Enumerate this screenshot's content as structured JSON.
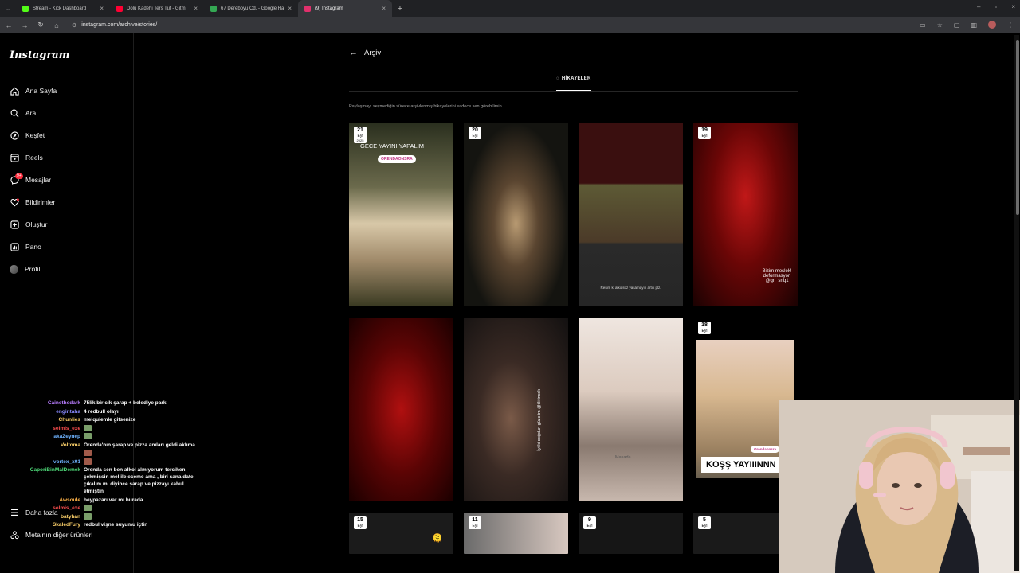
{
  "browser": {
    "tabs": [
      {
        "title": "Stream - Kick Dashboard",
        "favicon_color": "#53fc18"
      },
      {
        "title": "Dolu Kadehi Ters Tut - Gitm",
        "favicon_color": "#ff0033"
      },
      {
        "title": "67 Dereboyu Cd. - Google Har",
        "favicon_color": "#34a853"
      },
      {
        "title": "(9) Instagram",
        "favicon_color": "#e1306c"
      }
    ],
    "url": "instagram.com/archive/stories/"
  },
  "sidebar": {
    "logo": "Instagram",
    "items": [
      {
        "label": "Ana Sayfa",
        "icon": "home-icon"
      },
      {
        "label": "Ara",
        "icon": "search-icon"
      },
      {
        "label": "Keşfet",
        "icon": "compass-icon"
      },
      {
        "label": "Reels",
        "icon": "reels-icon"
      },
      {
        "label": "Mesajlar",
        "icon": "messenger-icon",
        "badge": "9+"
      },
      {
        "label": "Bildirimler",
        "icon": "heart-icon"
      },
      {
        "label": "Oluştur",
        "icon": "plus-square-icon"
      },
      {
        "label": "Pano",
        "icon": "dashboard-icon"
      },
      {
        "label": "Profil",
        "icon": "profile-avatar"
      }
    ],
    "more_label": "Daha fazla",
    "meta_label": "Meta'nın diğer ürünleri"
  },
  "main": {
    "title": "Arşiv",
    "tab_label": "HİKAYELER",
    "hint": "Paylaşmayı seçmediğin sürece arşivlenmiş hikayelerini sadece sen görebilirsin.",
    "stories": [
      {
        "day": "21",
        "month": "Eyl",
        "year": "2025",
        "caption": "GECE YAYINI YAPALIM",
        "tag": "ORENDAONSRA"
      },
      {
        "day": "20",
        "month": "Eyl",
        "year": "",
        "caption": "",
        "tag": ""
      },
      {
        "day": "",
        "month": "",
        "year": "",
        "caption": "Resim ki alkolsüz yaşamayın artık plz.",
        "tag": ""
      },
      {
        "day": "19",
        "month": "Eyl",
        "year": "",
        "caption": "Bizim meslek! deformasyon @gn_snq1",
        "tag": ""
      },
      {
        "day": "",
        "month": "",
        "year": "",
        "caption": "",
        "tag": ""
      },
      {
        "day": "",
        "month": "",
        "year": "",
        "caption": "İyi ki doğdun güzelim @illirinssk",
        "tag": ""
      },
      {
        "day": "",
        "month": "",
        "year": "",
        "caption": "Masada",
        "tag": ""
      },
      {
        "day": "18",
        "month": "Eyl",
        "year": "",
        "caption": "KOŞŞ YAYIIINNN",
        "tag": "Orendaonsra"
      },
      {
        "day": "15",
        "month": "Eyl",
        "year": "",
        "caption": "",
        "tag": ""
      },
      {
        "day": "11",
        "month": "Eyl",
        "year": "",
        "caption": "",
        "tag": ""
      },
      {
        "day": "9",
        "month": "Eyl",
        "year": "",
        "caption": "",
        "tag": ""
      },
      {
        "day": "5",
        "month": "Eyl",
        "year": "",
        "caption": "",
        "tag": ""
      }
    ]
  },
  "chat": [
    {
      "user": "Cainethedark",
      "color": "#b87cff",
      "msg": "75lik birlcik şarap + belediye parkı"
    },
    {
      "user": "engintaha",
      "color": "#8a8aff",
      "msg": "4 redbull olayı"
    },
    {
      "user": "Chunlies",
      "color": "#ffd36b",
      "msg": "melquiemle gitsenize"
    },
    {
      "user": "selmis_exe",
      "color": "#ff4f4f",
      "msg": ""
    },
    {
      "user": "akaZeynep",
      "color": "#6fb3ff",
      "msg": ""
    },
    {
      "user": "Voltoma",
      "color": "#ffd36b",
      "msg": "Orenda'nın şarap ve pizza anıları geldi aklıma"
    },
    {
      "user": "",
      "color": "#ffffff",
      "msg": ""
    },
    {
      "user": "vortex_x01",
      "color": "#6fb3ff",
      "msg": ""
    },
    {
      "user": "CaporiBinMalDemek",
      "color": "#4fdc7a",
      "msg": "Orenda sen ben alkol almıyorum tercihen çekmişsin mel ile eceme ama , biri sana date çıkalım mı diyince şarap ve pizzayı kabul etmiştin"
    },
    {
      "user": "Awsoule",
      "color": "#ffb347",
      "msg": "beypazarı var mı burada"
    },
    {
      "user": "selmis_exe",
      "color": "#ff4f4f",
      "msg": ""
    },
    {
      "user": "batyhan",
      "color": "#ffd36b",
      "msg": ""
    },
    {
      "user": "SkaledFury",
      "color": "#ffd36b",
      "msg": "redbul vişne suyumu içtin"
    }
  ]
}
